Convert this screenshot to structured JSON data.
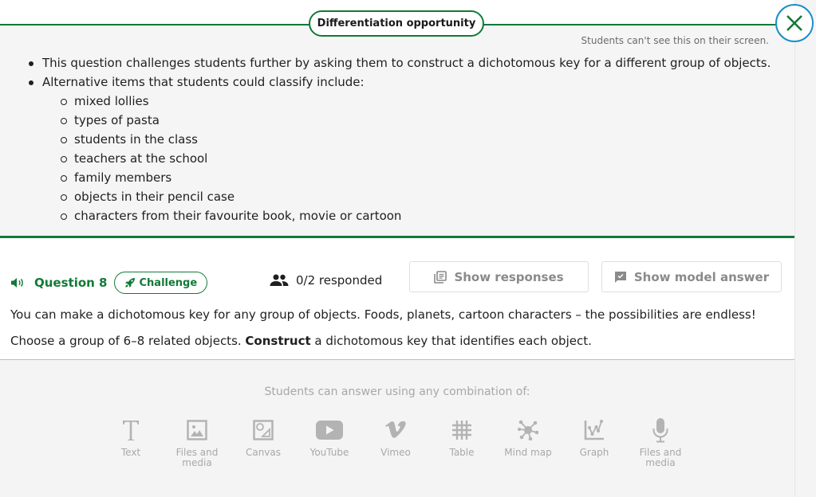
{
  "differentiation": {
    "title": "Differentiation opportunity",
    "note": "Students can't see this on their screen.",
    "bullets": [
      "This question challenges students further by asking them to construct a dichotomous key for a different group of objects.",
      "Alternative items that students could classify include:"
    ],
    "sub_items": [
      "mixed lollies",
      "types of pasta",
      "students in the class",
      "teachers at the school",
      "family members",
      "objects in their pencil case",
      "characters from their favourite book, movie or cartoon"
    ]
  },
  "close_icon": "close-icon",
  "question": {
    "title": "Question 8",
    "badge": "Challenge",
    "responded": "0/2 responded",
    "show_responses": "Show responses",
    "show_model_answer": "Show model answer",
    "line1": "You can make a dichotomous key for any group of objects. Foods, planets, cartoon characters – the possibilities are endless!",
    "line2_pre": "Choose a group of 6–8 related objects. ",
    "line2_bold": "Construct",
    "line2_post": " a dichotomous key that identifies each object."
  },
  "answer_tools": {
    "label": "Students can answer using any combination of:",
    "tools": [
      {
        "label": "Text",
        "icon": "text-icon"
      },
      {
        "label": "Files and media",
        "icon": "image-icon"
      },
      {
        "label": "Canvas",
        "icon": "canvas-icon"
      },
      {
        "label": "YouTube",
        "icon": "youtube-icon"
      },
      {
        "label": "Vimeo",
        "icon": "vimeo-icon"
      },
      {
        "label": "Table",
        "icon": "table-icon"
      },
      {
        "label": "Mind map",
        "icon": "mind-map-icon"
      },
      {
        "label": "Graph",
        "icon": "graph-icon"
      },
      {
        "label": "Files and media",
        "icon": "microphone-icon"
      }
    ]
  },
  "colors": {
    "accent_green": "#117a36",
    "close_ring": "#1a8ec9",
    "muted_gray": "#a8a8a8"
  }
}
